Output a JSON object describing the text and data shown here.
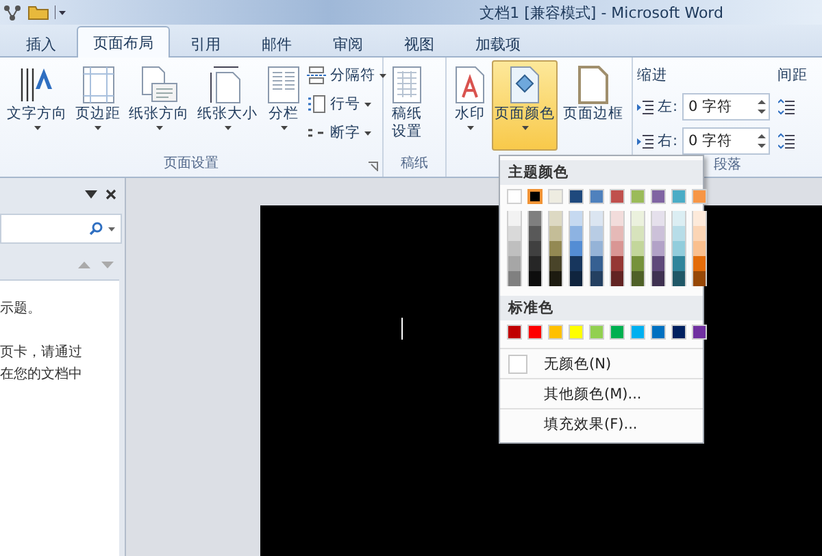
{
  "window": {
    "title": "文档1 [兼容模式] - Microsoft Word"
  },
  "tabs": [
    {
      "label": "插入",
      "selected": false
    },
    {
      "label": "页面布局",
      "selected": true
    },
    {
      "label": "引用",
      "selected": false
    },
    {
      "label": "邮件",
      "selected": false
    },
    {
      "label": "审阅",
      "selected": false
    },
    {
      "label": "视图",
      "selected": false
    },
    {
      "label": "加载项",
      "selected": false
    }
  ],
  "ribbon": {
    "page_setup": {
      "label": "页面设置",
      "large_buttons": [
        "文字方向",
        "页边距",
        "纸张方向",
        "纸张大小",
        "分栏"
      ],
      "small_buttons": [
        "分隔符",
        "行号",
        "断字"
      ]
    },
    "draft": {
      "label": "稿纸",
      "button": "稿纸设置"
    },
    "page_background": {
      "buttons": [
        {
          "label": "水印",
          "selected": false
        },
        {
          "label": "页面颜色",
          "selected": true
        },
        {
          "label": "页面边框",
          "selected": false
        }
      ]
    },
    "paragraph": {
      "label": "段落",
      "indent_label": "缩进",
      "indent": [
        {
          "label": "左:",
          "value": "0 字符"
        },
        {
          "label": "右:",
          "value": "0 字符"
        }
      ],
      "spacing_label": "间距"
    }
  },
  "nav_pane": {
    "texts": [
      "示题。",
      "页卡，请通过",
      "在您的文档中"
    ]
  },
  "color_menu": {
    "theme_label": "主题颜色",
    "theme": [
      {
        "color": "#ffffff",
        "selected": false,
        "shades": [
          {
            "color": "#f2f2f2"
          },
          {
            "color": "#d9d9d9"
          },
          {
            "color": "#bfbfbf"
          },
          {
            "color": "#a6a6a6"
          },
          {
            "color": "#808080"
          }
        ]
      },
      {
        "color": "#000000",
        "selected": true,
        "shades": [
          {
            "color": "#7f7f7f"
          },
          {
            "color": "#595959"
          },
          {
            "color": "#404040"
          },
          {
            "color": "#262626"
          },
          {
            "color": "#0d0d0d"
          }
        ]
      },
      {
        "color": "#eeece1",
        "selected": false,
        "shades": [
          {
            "color": "#ddd9c3"
          },
          {
            "color": "#c4bd97"
          },
          {
            "color": "#938953"
          },
          {
            "color": "#494429"
          },
          {
            "color": "#1d1b10"
          }
        ]
      },
      {
        "color": "#1f497d",
        "selected": false,
        "shades": [
          {
            "color": "#c6d9f0"
          },
          {
            "color": "#8db3e2"
          },
          {
            "color": "#548dd4"
          },
          {
            "color": "#17365d"
          },
          {
            "color": "#0f243e"
          }
        ]
      },
      {
        "color": "#4f81bd",
        "selected": false,
        "shades": [
          {
            "color": "#dbe5f1"
          },
          {
            "color": "#b8cce4"
          },
          {
            "color": "#95b3d7"
          },
          {
            "color": "#366092"
          },
          {
            "color": "#244061"
          }
        ]
      },
      {
        "color": "#c0504d",
        "selected": false,
        "shades": [
          {
            "color": "#f2dcdb"
          },
          {
            "color": "#e5b9b7"
          },
          {
            "color": "#d99694"
          },
          {
            "color": "#953734"
          },
          {
            "color": "#632423"
          }
        ]
      },
      {
        "color": "#9bbb59",
        "selected": false,
        "shades": [
          {
            "color": "#ebf1dd"
          },
          {
            "color": "#d7e3bc"
          },
          {
            "color": "#c3d69b"
          },
          {
            "color": "#76923c"
          },
          {
            "color": "#4f6128"
          }
        ]
      },
      {
        "color": "#8064a2",
        "selected": false,
        "shades": [
          {
            "color": "#e5e0ec"
          },
          {
            "color": "#ccc1d9"
          },
          {
            "color": "#b2a2c7"
          },
          {
            "color": "#5f497a"
          },
          {
            "color": "#3f3151"
          }
        ]
      },
      {
        "color": "#4bacc6",
        "selected": false,
        "shades": [
          {
            "color": "#dbeef3"
          },
          {
            "color": "#b7dde8"
          },
          {
            "color": "#92cddc"
          },
          {
            "color": "#31859b"
          },
          {
            "color": "#205867"
          }
        ]
      },
      {
        "color": "#f79646",
        "selected": false,
        "shades": [
          {
            "color": "#fdeada"
          },
          {
            "color": "#fbd5b5"
          },
          {
            "color": "#fac08f"
          },
          {
            "color": "#e36c09"
          },
          {
            "color": "#974806"
          }
        ]
      }
    ],
    "standard_label": "标准色",
    "standard": [
      {
        "color": "#c00000"
      },
      {
        "color": "#ff0000"
      },
      {
        "color": "#ffc000"
      },
      {
        "color": "#ffff00"
      },
      {
        "color": "#92d050"
      },
      {
        "color": "#00b050"
      },
      {
        "color": "#00b0f0"
      },
      {
        "color": "#0070c0"
      },
      {
        "color": "#002060"
      },
      {
        "color": "#7030a0"
      }
    ],
    "items": [
      {
        "kind": "no-color",
        "label": "无颜色(N)"
      },
      {
        "kind": "more",
        "label": "其他颜色(M)..."
      },
      {
        "kind": "fill",
        "label": "填充效果(F)..."
      }
    ]
  }
}
